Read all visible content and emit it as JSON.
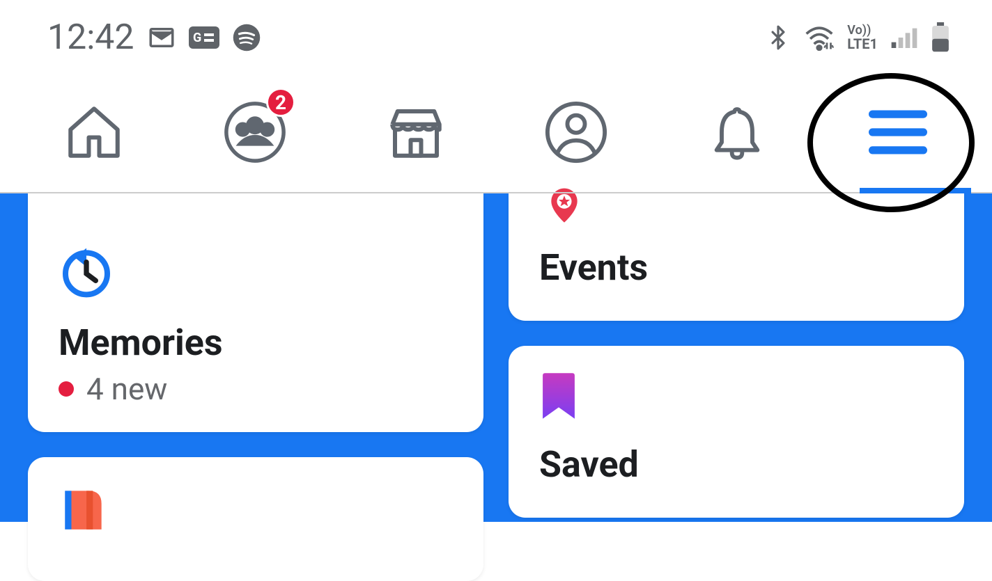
{
  "status": {
    "time": "12:42",
    "network_label": "LTE1",
    "vo_label": "Vo))"
  },
  "nav": {
    "groups_badge": "2"
  },
  "cards": {
    "memories": {
      "title": "Memories",
      "sub": "4 new"
    },
    "events": {
      "title": "Events"
    },
    "saved": {
      "title": "Saved"
    }
  }
}
